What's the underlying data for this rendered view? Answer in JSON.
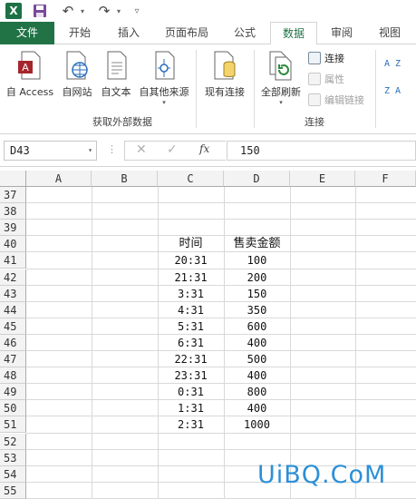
{
  "quick_access": {
    "app_icon": "excel-icon",
    "save_icon": "save-icon",
    "undo_icon": "undo-icon",
    "redo_icon": "redo-icon",
    "customize_icon": "customize-icon"
  },
  "tabs": [
    {
      "label": "文件"
    },
    {
      "label": "开始"
    },
    {
      "label": "插入"
    },
    {
      "label": "页面布局"
    },
    {
      "label": "公式"
    },
    {
      "label": "数据",
      "active": true
    },
    {
      "label": "审阅"
    },
    {
      "label": "视图"
    }
  ],
  "ribbon": {
    "external_group": {
      "label": "获取外部数据",
      "buttons": [
        {
          "label": "自 Access",
          "icon": "access-icon"
        },
        {
          "label": "自网站",
          "icon": "web-icon"
        },
        {
          "label": "自文本",
          "icon": "text-file-icon"
        },
        {
          "label": "自其他来源",
          "icon": "other-sources-icon"
        }
      ]
    },
    "existing_connections": {
      "label": "现有连接",
      "icon": "existing-connections-icon"
    },
    "connections_group": {
      "label": "连接",
      "refresh_all": {
        "label": "全部刷新",
        "icon": "refresh-all-icon"
      },
      "connections": {
        "label": "连接"
      },
      "properties": {
        "label": "属性"
      },
      "edit_links": {
        "label": "编辑链接"
      }
    },
    "sort": {
      "asc_label": "A Z",
      "desc_label": "Z A"
    }
  },
  "formula_bar": {
    "name_box": "D43",
    "fx_label": "fx",
    "value": "150"
  },
  "sheet": {
    "columns": [
      "A",
      "B",
      "C",
      "D",
      "E",
      "F"
    ],
    "rows": [
      "37",
      "38",
      "39",
      "40",
      "41",
      "42",
      "43",
      "44",
      "45",
      "46",
      "47",
      "48",
      "49",
      "50",
      "51",
      "52",
      "53",
      "54",
      "55"
    ],
    "headers": {
      "c": "时间",
      "d": "售卖金额"
    },
    "data": [
      {
        "time": "20:31",
        "amount": "100"
      },
      {
        "time": "21:31",
        "amount": "200"
      },
      {
        "time": "3:31",
        "amount": "150"
      },
      {
        "time": "4:31",
        "amount": "350"
      },
      {
        "time": "5:31",
        "amount": "600"
      },
      {
        "time": "6:31",
        "amount": "400"
      },
      {
        "time": "22:31",
        "amount": "500"
      },
      {
        "time": "23:31",
        "amount": "400"
      },
      {
        "time": "0:31",
        "amount": "800"
      },
      {
        "time": "1:31",
        "amount": "400"
      },
      {
        "time": "2:31",
        "amount": "1000"
      }
    ]
  },
  "watermark": "UiBQ.CoM",
  "colors": {
    "excel_green": "#217346",
    "watermark_blue": "#2d8fd6"
  }
}
